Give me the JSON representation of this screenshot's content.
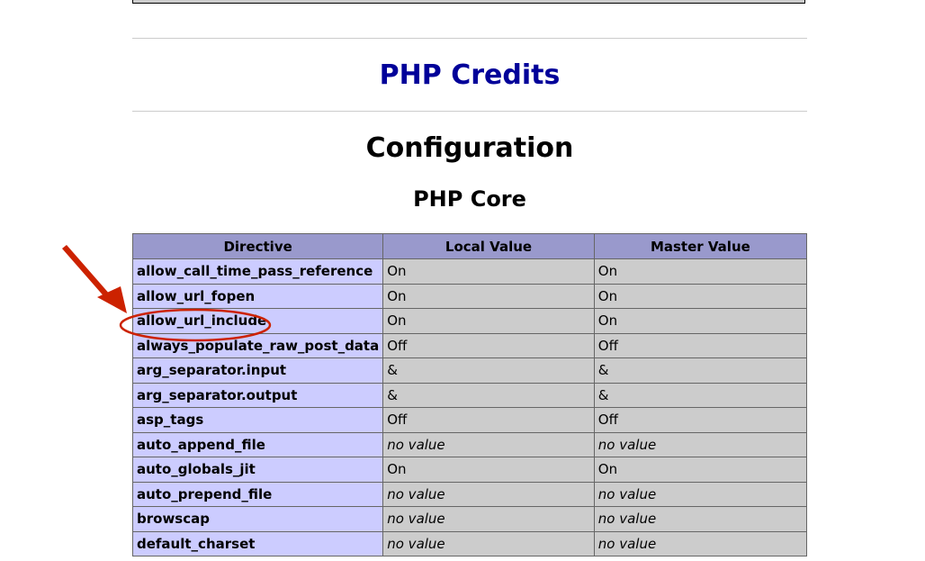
{
  "sections": {
    "credits_link": "PHP Credits",
    "configuration_heading": "Configuration",
    "core_heading": "PHP Core"
  },
  "table": {
    "headers": [
      "Directive",
      "Local Value",
      "Master Value"
    ],
    "rows": [
      {
        "directive": "allow_call_time_pass_reference",
        "local": "On",
        "master": "On",
        "novalue": false
      },
      {
        "directive": "allow_url_fopen",
        "local": "On",
        "master": "On",
        "novalue": false
      },
      {
        "directive": "allow_url_include",
        "local": "On",
        "master": "On",
        "novalue": false
      },
      {
        "directive": "always_populate_raw_post_data",
        "local": "Off",
        "master": "Off",
        "novalue": false
      },
      {
        "directive": "arg_separator.input",
        "local": "&",
        "master": "&",
        "novalue": false
      },
      {
        "directive": "arg_separator.output",
        "local": "&",
        "master": "&",
        "novalue": false
      },
      {
        "directive": "asp_tags",
        "local": "Off",
        "master": "Off",
        "novalue": false
      },
      {
        "directive": "auto_append_file",
        "local": "no value",
        "master": "no value",
        "novalue": true
      },
      {
        "directive": "auto_globals_jit",
        "local": "On",
        "master": "On",
        "novalue": false
      },
      {
        "directive": "auto_prepend_file",
        "local": "no value",
        "master": "no value",
        "novalue": true
      },
      {
        "directive": "browscap",
        "local": "no value",
        "master": "no value",
        "novalue": true
      },
      {
        "directive": "default_charset",
        "local": "no value",
        "master": "no value",
        "novalue": true
      }
    ]
  },
  "colors": {
    "header_bg": "#9999cc",
    "directive_bg": "#ccccff",
    "value_bg": "#cccccc",
    "link": "#000099",
    "annotation": "#cc2200"
  },
  "annotation": {
    "icon": "red-arrow-icon",
    "highlight": "red-ellipse-highlight",
    "target_row": "allow_url_include"
  }
}
